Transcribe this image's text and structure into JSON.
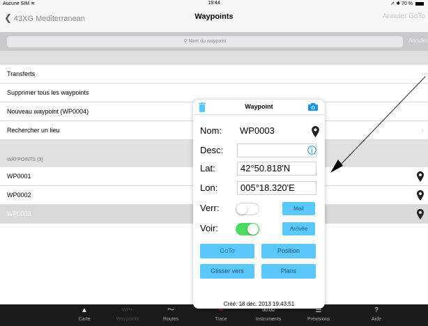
{
  "status": {
    "carrier": "Aucune SIM",
    "time": "19:44",
    "battery": "70 %"
  },
  "nav": {
    "back_label": "43XG Mediterranean",
    "title": "Waypoints",
    "right_label": "Annuler GoTo"
  },
  "search": {
    "placeholder": "Nom du waypoint",
    "cancel": "Annuler"
  },
  "menu": [
    {
      "label": "Transferts",
      "chevron": true
    },
    {
      "label": "Supprimer tous les waypoints",
      "chevron": false
    },
    {
      "label": "Nouveau waypoint (WP0004)",
      "chevron": false
    },
    {
      "label": "Rechercher un lieu",
      "chevron": true
    }
  ],
  "section_header": "WAYPOINTS (3)",
  "waypoints": [
    "WP0001",
    "WP0002",
    "WP0003"
  ],
  "popover": {
    "title": "Waypoint",
    "fields": {
      "nom_label": "Nom:",
      "nom_value": "WP0003",
      "desc_label": "Desc:",
      "desc_value": "",
      "lat_label": "Lat:",
      "lat_value": "42°50.818'N",
      "lon_label": "Lon:",
      "lon_value": "005°18.320'E"
    },
    "verr_label": "Verr:",
    "verr_on": false,
    "voir_label": "Voir:",
    "voir_on": true,
    "buttons": {
      "mail": "Mail",
      "arrivee": "Arrivée",
      "goto": "GoTo",
      "position": "Position",
      "glisser": "Glisser vers",
      "plans": "Plans"
    },
    "created": "Créé: 18 déc. 2013 19:43:51"
  },
  "tabs": [
    {
      "label": "Carte",
      "dim": false
    },
    {
      "label": "Waypoints",
      "dim": true
    },
    {
      "label": "Routes",
      "dim": false
    },
    {
      "label": "Trace",
      "dim": false
    },
    {
      "label": "Instruments",
      "dim": false,
      "icon_text": "00.00"
    },
    {
      "label": "Prévisions",
      "dim": false
    },
    {
      "label": "Aide",
      "dim": false,
      "icon_text": "?"
    }
  ],
  "colors": {
    "accent_blue": "#5ac8fa",
    "toggle_on": "#4cd964",
    "tabbar": "#1a1a1a"
  }
}
